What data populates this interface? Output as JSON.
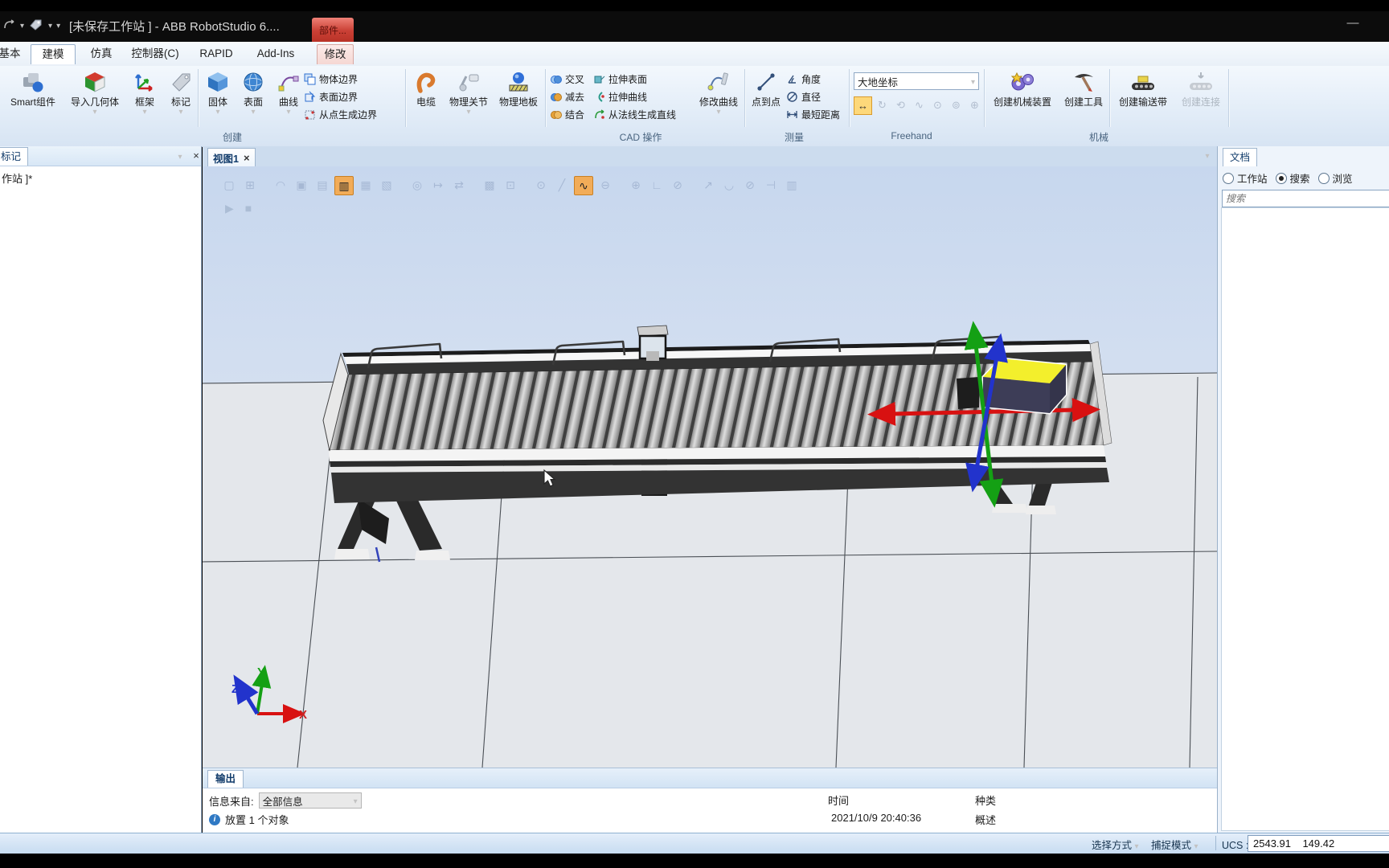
{
  "title_bar": {
    "title": "[未保存工作站 ] - ABB RobotStudio 6....",
    "context_group_tab": "部件..."
  },
  "tabs": {
    "basic": "基本",
    "modeling": "建模",
    "simulation": "仿真",
    "controller": "控制器(C)",
    "rapid": "RAPID",
    "addins": "Add-Ins",
    "modify": "修改"
  },
  "ribbon": {
    "group_labels": {
      "create": "创建",
      "cad": "CAD 操作",
      "measure": "测量",
      "freehand": "Freehand",
      "mechanism": "机械"
    },
    "smart_component": "Smart组件",
    "import_geometry": "导入几何体",
    "frame": "框架",
    "tag": "标记",
    "solid": "固体",
    "surface": "表面",
    "curve": "曲线",
    "body_border": "物体边界",
    "surface_border": "表面边界",
    "border_from_points": "从点生成边界",
    "cable": "电缆",
    "physical_joint": "物理关节",
    "physical_floor": "物理地板",
    "intersect": "交叉",
    "subtract": "减去",
    "union": "结合",
    "extrude_surface": "拉伸表面",
    "extrude_curve": "拉伸曲线",
    "line_from_normal": "从法线生成直线",
    "modify_curve": "修改曲线",
    "point_to_point": "点到点",
    "angle": "角度",
    "diameter": "直径",
    "min_distance": "最短距离",
    "reference_combo": "大地坐标",
    "create_mechanism": "创建机械装置",
    "create_tool": "创建工具",
    "create_conveyor": "创建输送带",
    "create_connection": "创建连接"
  },
  "freehand_tools": [
    {
      "name": "move-tool",
      "glyph": "↔",
      "active": true
    },
    {
      "name": "rotate-tool",
      "glyph": "↻",
      "active": false
    },
    {
      "name": "pan-tool",
      "glyph": "⟲",
      "active": false
    },
    {
      "name": "jog-joint-tool",
      "glyph": "∿",
      "active": false
    },
    {
      "name": "jog-linear-tool",
      "glyph": "⊙",
      "active": false
    },
    {
      "name": "jog-reorient-tool",
      "glyph": "⊚",
      "active": false
    },
    {
      "name": "multirobot-jog-tool",
      "glyph": "⊕",
      "active": false
    }
  ],
  "left_panel": {
    "tab": "标记",
    "tree_text": "作站 ]*"
  },
  "viewport": {
    "tab": "视图1"
  },
  "viewport_toolbar": {
    "play_glyph": "▶",
    "stop_glyph": "■",
    "tools": [
      {
        "name": "view-style",
        "glyph": "▢",
        "active": false
      },
      {
        "name": "zoom-window",
        "glyph": "⊞",
        "active": false,
        "gap_after": true
      },
      {
        "name": "select-curve",
        "glyph": "◠",
        "active": false
      },
      {
        "name": "select-surface",
        "glyph": "▣",
        "active": false
      },
      {
        "name": "select-body",
        "glyph": "▤",
        "active": false
      },
      {
        "name": "select-part",
        "glyph": "▥",
        "active": true
      },
      {
        "name": "select-group",
        "glyph": "▦",
        "active": false
      },
      {
        "name": "select-mechanism",
        "glyph": "▧",
        "active": false,
        "gap_after": true
      },
      {
        "name": "select-target",
        "glyph": "◎",
        "active": false
      },
      {
        "name": "select-move-instr",
        "glyph": "↦",
        "active": false
      },
      {
        "name": "select-path",
        "glyph": "⇄",
        "active": false,
        "gap_after": true
      },
      {
        "name": "snap-grid",
        "glyph": "▩",
        "active": false
      },
      {
        "name": "snap-object-center",
        "glyph": "⊡",
        "active": false,
        "gap_after": true
      },
      {
        "name": "snap-center",
        "glyph": "⊙",
        "active": false
      },
      {
        "name": "snap-midpoint",
        "glyph": "╱",
        "active": false
      },
      {
        "name": "snap-endpoint",
        "glyph": "∿",
        "active": true
      },
      {
        "name": "snap-edge",
        "glyph": "⊖",
        "active": false,
        "gap_after": true
      },
      {
        "name": "snap-gravity",
        "glyph": "⊕",
        "active": false
      },
      {
        "name": "snap-local-origin",
        "glyph": "∟",
        "active": false
      },
      {
        "name": "snap-ucs",
        "glyph": "⊘",
        "active": false,
        "gap_after": true
      },
      {
        "name": "measure-point-to-point",
        "glyph": "↗",
        "active": false
      },
      {
        "name": "measure-angle",
        "glyph": "◡",
        "active": false
      },
      {
        "name": "measure-diameter",
        "glyph": "⊘",
        "active": false
      },
      {
        "name": "measure-min-distance",
        "glyph": "⊣",
        "active": false
      },
      {
        "name": "measure-history",
        "glyph": "▥",
        "active": false
      }
    ]
  },
  "scene": {
    "axis_x": "X",
    "axis_y": "Y",
    "axis_z": "Z"
  },
  "doc_panel": {
    "tab": "文档",
    "radio_workstation": "工作站",
    "radio_search": "搜索",
    "radio_browse": "浏览",
    "search_placeholder": "搜索"
  },
  "output": {
    "tab": "输出",
    "source_label": "信息来自:",
    "source_value": "全部信息",
    "col_time": "时间",
    "col_category": "种类",
    "msg": "放置 1 个对象",
    "time": "2021/10/9 20:40:36",
    "category": "概述"
  },
  "status_bar": {
    "selection_mode": "选择方式",
    "snap_mode": "捕捉模式",
    "ucs": "UCS : 工作站",
    "coordinates": "2543.91    149.42"
  },
  "colors": {
    "axis_x_red": "#d81111",
    "axis_y_green": "#14a014",
    "axis_z_blue": "#2233cc",
    "box_top_yellow": "#f3ef2c",
    "box_side_navy": "#3d3d57",
    "tool_highlight_orange": "#f2ac58",
    "context_tab_red": "#ca4035"
  }
}
